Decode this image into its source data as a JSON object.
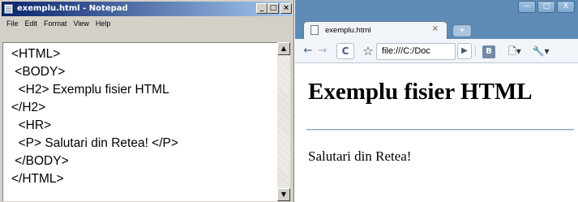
{
  "notepad": {
    "title": "exemplu.html - Notepad",
    "controls": {
      "minimize": "_",
      "maximize": "□",
      "close": "×"
    },
    "menu": [
      "File",
      "Edit",
      "Format",
      "View",
      "Help"
    ],
    "lines": [
      "<HTML>",
      " <BODY>",
      "  <H2> Exemplu fisier HTML",
      "</H2>",
      "  <HR>",
      "  <P> Salutari din Retea! </P>",
      " </BODY>",
      "</HTML>"
    ],
    "scroll": {
      "up": "▲",
      "down": "▼"
    }
  },
  "browser": {
    "window_controls": {
      "minimize": "—",
      "maximize": "□",
      "close": "X"
    },
    "tab": {
      "title": "exemplu.html",
      "close": "×"
    },
    "new_tab": "+",
    "toolbar": {
      "back": "←",
      "forward": "→",
      "reload": "C",
      "star": "☆",
      "url": "file:///C:/Doc",
      "go": "▶",
      "bookmark": "B",
      "page_menu": "🗋▾",
      "wrench_menu": "🔧▾"
    },
    "page": {
      "heading": "Exemplu fisier HTML",
      "paragraph": "Salutari din Retea!"
    }
  },
  "colors": {
    "notepad_title_start": "#0a246a",
    "notepad_title_end": "#a6caf0",
    "browser_frame": "#5e8cb6",
    "hr": "#8ba3bd"
  }
}
